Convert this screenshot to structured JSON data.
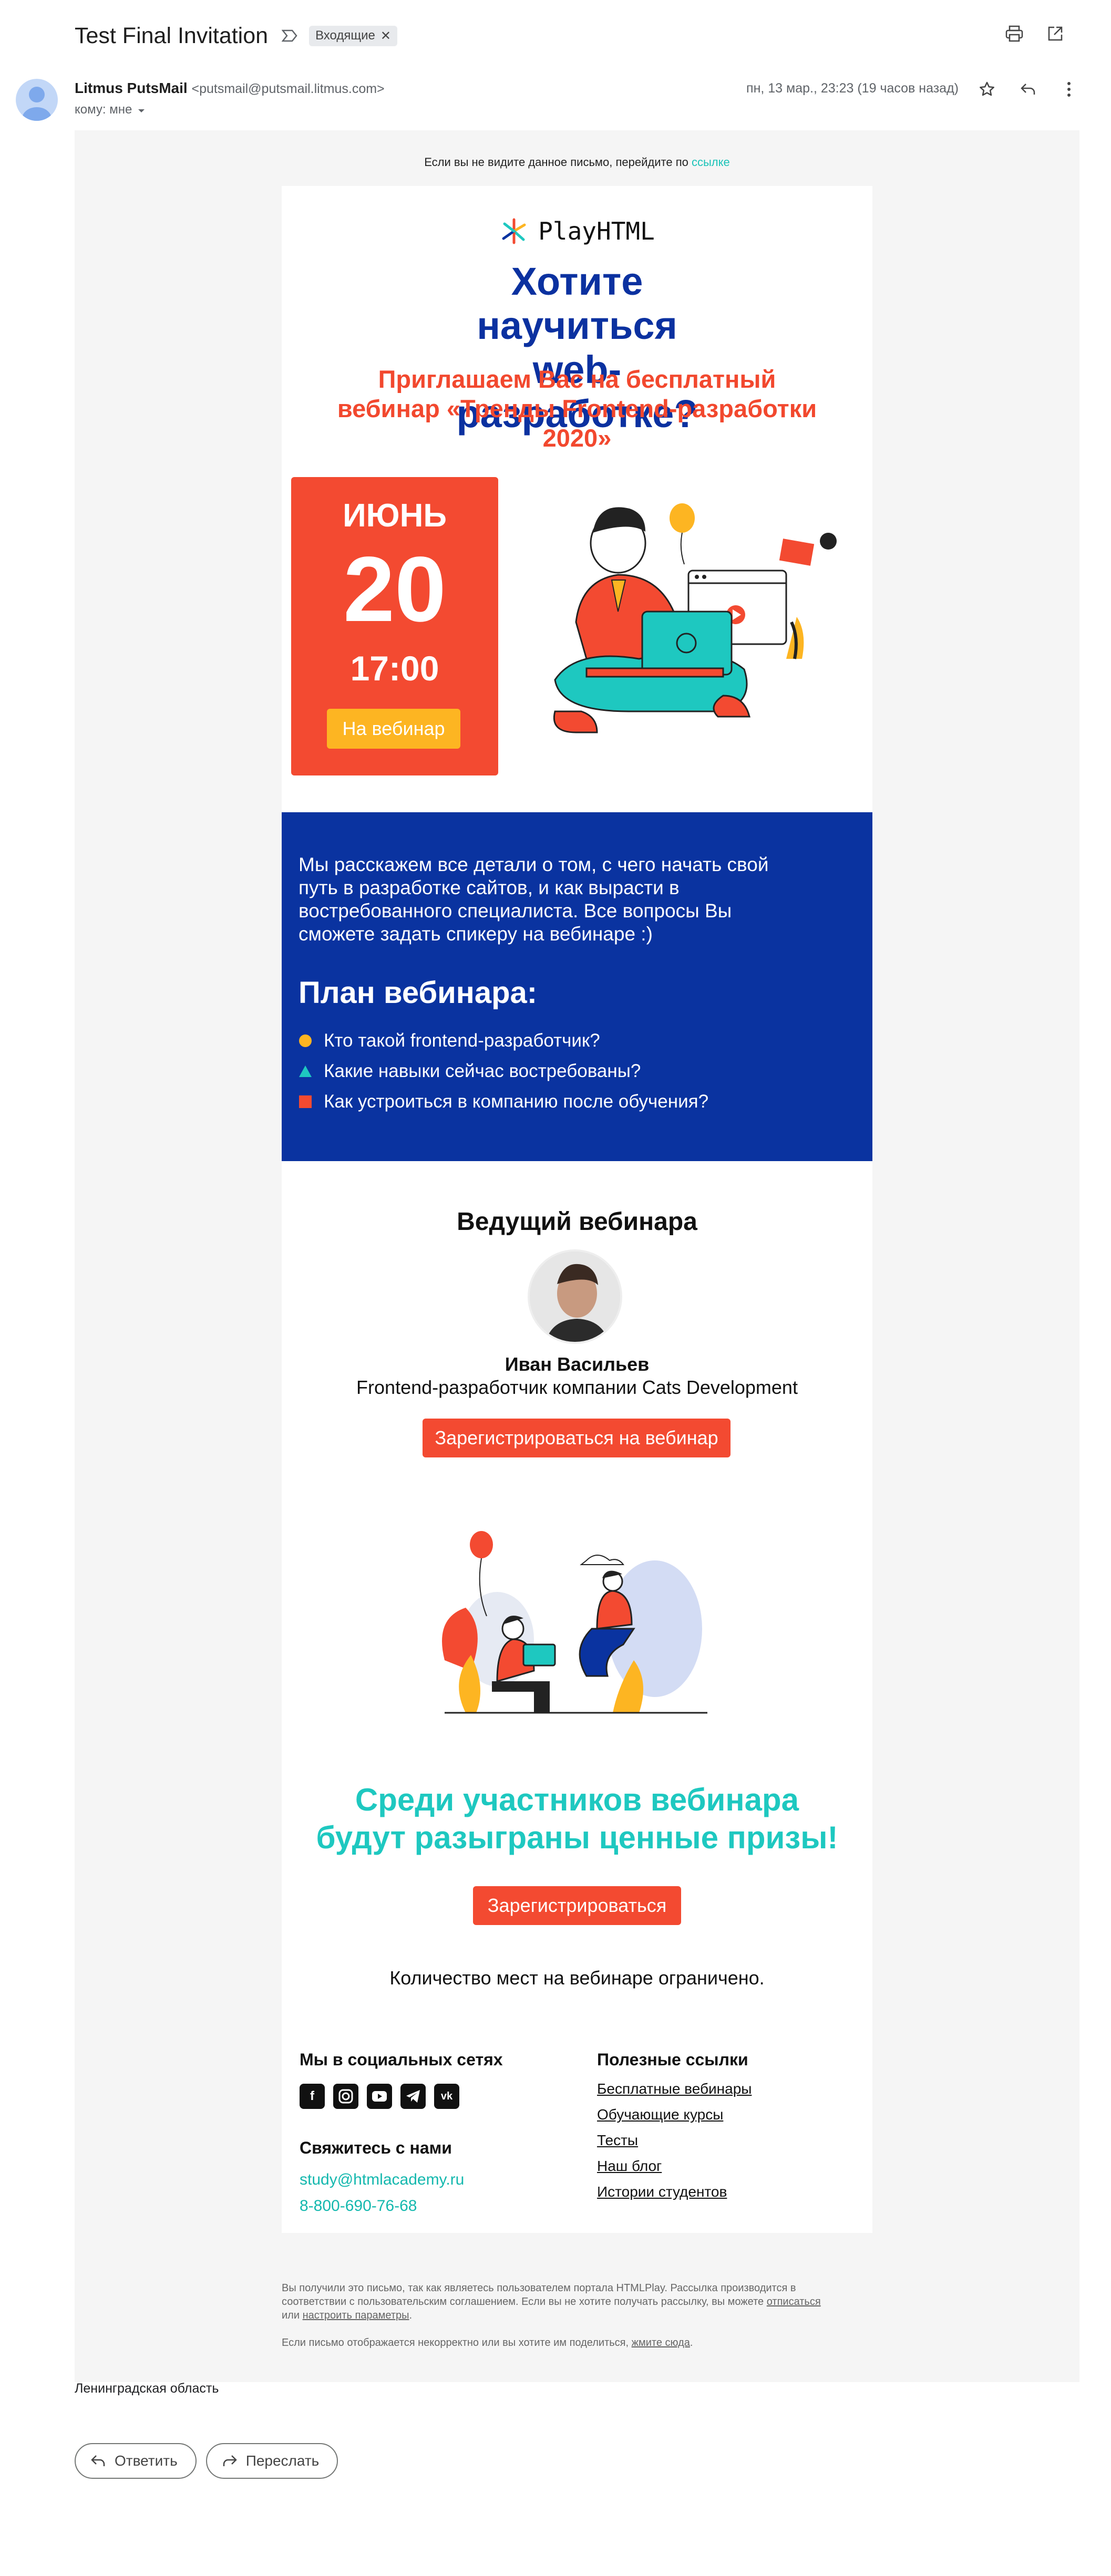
{
  "gmail": {
    "subject": "Test Final Invitation",
    "label": "Входящие",
    "sender_name": "Litmus PutsMail",
    "sender_email": "<putsmail@putsmail.litmus.com>",
    "to": "кому: мне",
    "date": "пн, 13 мар., 23:23 (19 часов назад)",
    "region": "Ленинградская область",
    "reply_label": "Ответить",
    "forward_label": "Переслать"
  },
  "email": {
    "preheader_text": "Если вы не видите данное письмо, перейдите по",
    "preheader_link": "ссылке",
    "logo": "PlayHTML",
    "headline": "Хотите научиться web-разработке?",
    "subheadline": "Приглашаем Вас на бесплатный вебинар «Тренды Frontend-разработки 2020»",
    "date_month": "ИЮНЬ",
    "date_day": "20",
    "date_time": "17:00",
    "date_button": "На вебинар",
    "intro": "Мы расскажем все детали о том, с чего начать свой путь в разработке сайтов, и как вырасти в востребованного специалиста. Все вопросы Вы сможете задать спикеру на вебинаре :)",
    "plan_title": "План вебинара:",
    "plan_items": [
      "Кто такой frontend-разработчик?",
      "Какие навыки сейчас востребованы?",
      "Как устроиться в компанию после обучения?"
    ],
    "host_title": "Ведущий вебинара",
    "host_name": "Иван Васильев",
    "host_role": "Frontend-разработчик компании Cats Development",
    "register_webinar": "Зарегистрироваться на вебинар",
    "prize_title": "Среди участников вебинара будут разыграны ценные призы!",
    "register": "Зарегистрироваться",
    "limited": "Количество мест на вебинаре ограничено.",
    "social_title": "Мы в социальных сетях",
    "contact_title": "Свяжитесь с нами",
    "contact_email": "study@htmlacademy.ru",
    "contact_phone": "8-800-690-76-68",
    "links_title": "Полезные ссылки",
    "links": [
      "Бесплатные вебинары",
      "Обучающие курсы",
      "Тесты",
      "Наш блог",
      "Истории студентов"
    ],
    "legal_1": "Вы получили это письмо, так как являетесь пользователем портала HTMLPlay. Рассылка производится в соответствии с пользовательским соглашением. Если вы не хотите получать рассылку, вы можете",
    "legal_unsubscribe": "отписаться",
    "legal_or": "или",
    "legal_settings": "настроить параметры",
    "legal_2": "Если письмо отображается некорректно или вы хотите им поделиться,",
    "legal_view": "жмите сюда"
  },
  "colors": {
    "brand_blue": "#0a33a0",
    "accent_red": "#f34a31",
    "accent_yellow": "#fdb522",
    "accent_teal": "#1ec8c0"
  }
}
